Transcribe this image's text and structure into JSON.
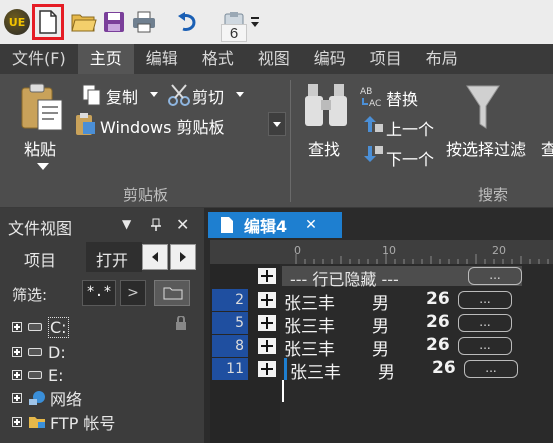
{
  "toolbar": {
    "logo_text": "UE",
    "tooltip_number": "6",
    "icons": [
      "new-file-icon",
      "open-folder-icon",
      "save-icon",
      "print-icon",
      "undo-icon",
      "clipboard-icon",
      "customize-dropdown-icon"
    ]
  },
  "tabs": [
    "文件(F)",
    "主页",
    "编辑",
    "格式",
    "视图",
    "编码",
    "项目",
    "布局"
  ],
  "active_tab": "主页",
  "ribbon": {
    "paste": "粘贴",
    "copy": "复制",
    "cut": "剪切",
    "clipboard_select": "Windows 剪贴板",
    "group_clipboard": "剪贴板",
    "find": "查找",
    "replace": "替换",
    "prev": "上一个",
    "next": "下一个",
    "filter": "按选择过滤",
    "filter_more": "查",
    "group_search": "搜索"
  },
  "file_view": {
    "title": "文件视图",
    "pin": "▼",
    "close": "✕",
    "tab_project": "项目",
    "tab_open": "打开",
    "filter_label": "筛选:",
    "filter_value": "*.*",
    "filter_arrow": ">",
    "tree": [
      {
        "label": "C:",
        "selected": true
      },
      {
        "label": "D:"
      },
      {
        "label": "E:"
      },
      {
        "label": "网络"
      },
      {
        "label": "FTP 帐号"
      }
    ]
  },
  "editor": {
    "tab_label": "编辑4",
    "tab_close": "✕",
    "ruler": [
      "0",
      "10",
      "20"
    ],
    "hidden_banner": "--- 行已隐藏 ---",
    "ellipsis": "...",
    "lines": [
      {
        "num": "2",
        "name": "张三丰",
        "gender": "男",
        "age": "26"
      },
      {
        "num": "5",
        "name": "张三丰",
        "gender": "男",
        "age": "26"
      },
      {
        "num": "8",
        "name": "张三丰",
        "gender": "男",
        "age": "26"
      },
      {
        "num": "11",
        "name": "张三丰",
        "gender": "男",
        "age": "26"
      }
    ]
  },
  "colors": {
    "accent": "#1e7fd0",
    "highlight": "#e51c24"
  }
}
